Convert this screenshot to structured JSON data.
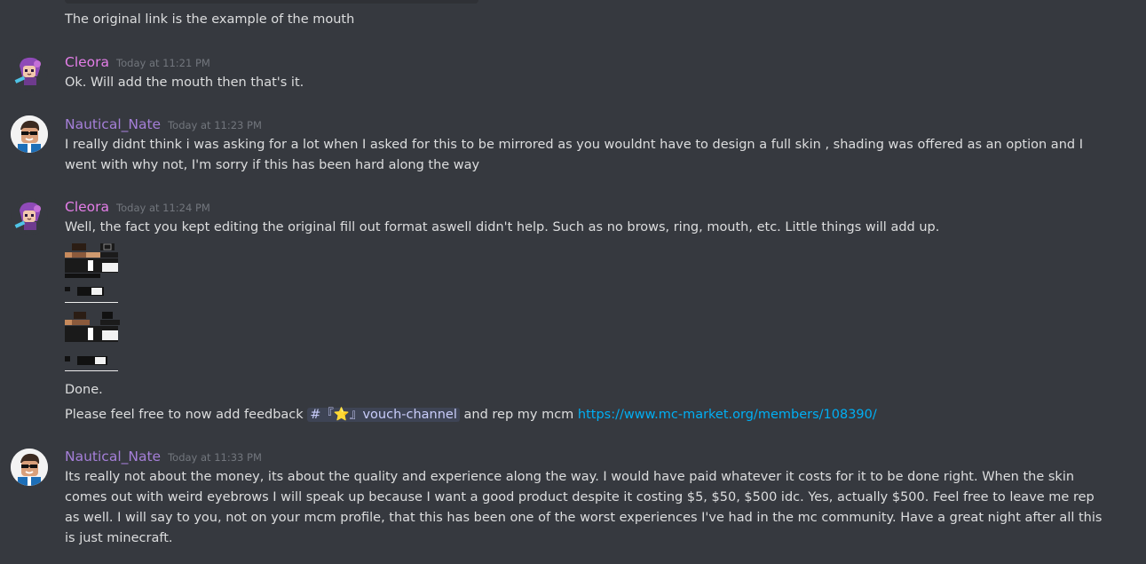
{
  "messages": {
    "prev_tail": "The original link is the example of the mouth",
    "m1": {
      "author": "Cleora",
      "timestamp": "Today at 11:21 PM",
      "text": "Ok. Will add the mouth then that's it."
    },
    "m2": {
      "author": "Nautical_Nate",
      "timestamp": "Today at 11:23 PM",
      "text": "I really didnt think i was asking for a lot when I asked for this to be mirrored as you wouldnt have to design a full skin , shading was offered as an option and I went with why not, I'm sorry if this has been hard along the way"
    },
    "m3": {
      "author": "Cleora",
      "timestamp": "Today at 11:24 PM",
      "text": "Well, the fact you kept editing the original fill out format aswell didn't help. Such as no brows, ring, mouth, etc. Little things will add up.",
      "done": "Done.",
      "feedback_before": "Please feel free to now add feedback",
      "channel_mention": "#『⭐』vouch-channel",
      "feedback_middle": "and rep my mcm",
      "link": "https://www.mc-market.org/members/108390/"
    },
    "m4": {
      "author": "Nautical_Nate",
      "timestamp": "Today at 11:33 PM",
      "text": "Its really not about the money, its about the quality and experience along the way.  I would have paid whatever it costs for it to be done right.  When the skin comes out with weird eyebrows I will speak up because I want a good product despite it costing $5, $50, $500 idc.  Yes, actually $500. Feel free to leave me rep as well.  I will say to you, not on your mcm profile, that this has been one of the worst experiences I've had in the mc community. Have a great night after all this is just minecraft."
    }
  },
  "colors": {
    "background": "#36393f",
    "cleora_name": "#e47ee8",
    "nate_name": "#a57fd8",
    "link": "#00aff4"
  }
}
